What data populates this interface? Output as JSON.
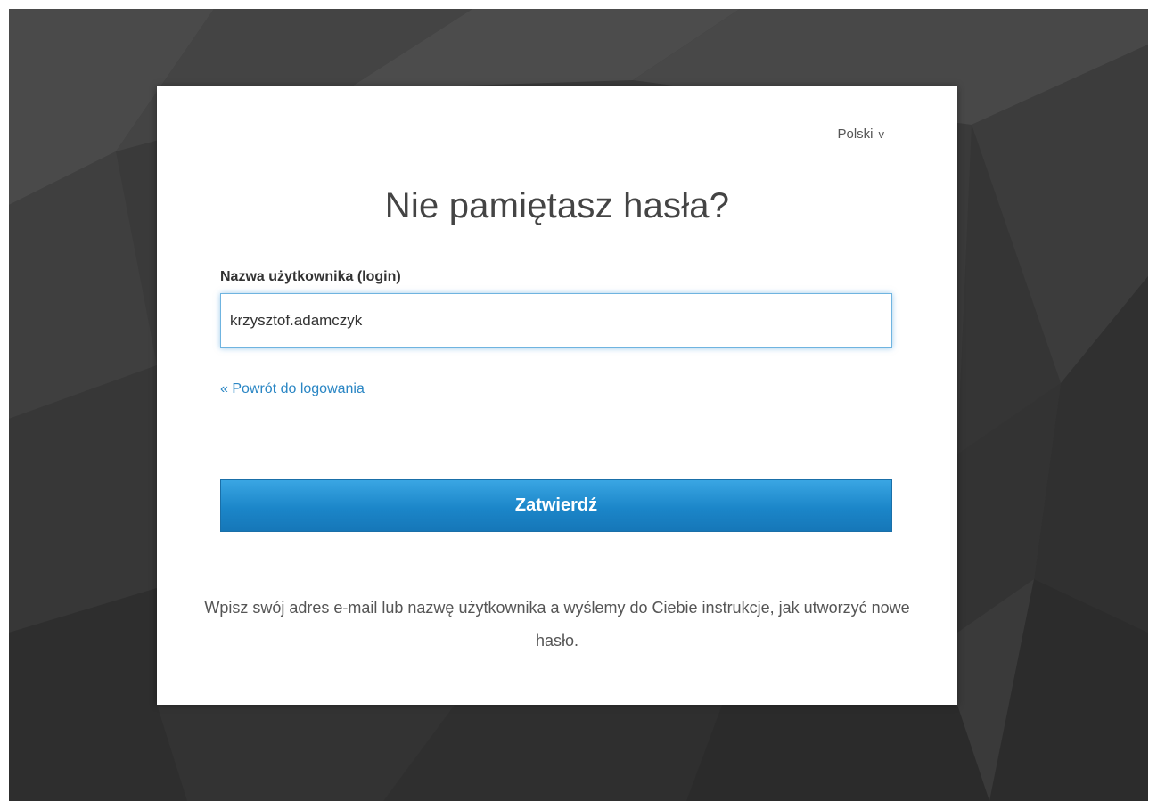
{
  "language": {
    "selected": "Polski",
    "caret": "v"
  },
  "form": {
    "title": "Nie pamiętasz hasła?",
    "username_label": "Nazwa użytkownika (login)",
    "username_value": "krzysztof.adamczyk",
    "back_link": "« Powrót do logowania",
    "submit_label": "Zatwierdź",
    "help_text": "Wpisz swój adres e-mail lub nazwę użytkownika a wyślemy do Ciebie instrukcje, jak utworzyć nowe hasło."
  },
  "colors": {
    "accent": "#1b86c9",
    "link": "#2a86c4",
    "background": "#3a3a3a"
  }
}
